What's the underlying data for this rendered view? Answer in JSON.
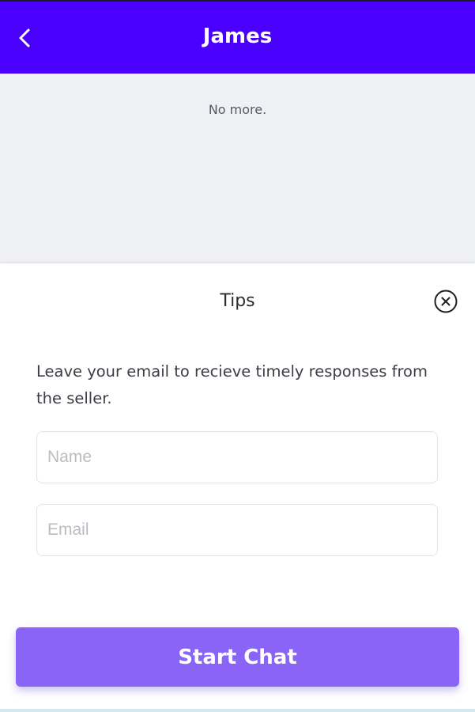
{
  "header": {
    "back_icon": "chevron-left-icon",
    "title": "James",
    "background_color": "#4a00ff"
  },
  "history": {
    "no_more_text": "No more."
  },
  "tips_sheet": {
    "title": "Tips",
    "close_icon": "close-circle-icon",
    "message": "Leave your email to recieve timely responses from the seller.",
    "name_input": {
      "value": "",
      "placeholder": "Name"
    },
    "email_input": {
      "value": "",
      "placeholder": "Email"
    },
    "start_button_label": "Start Chat",
    "button_color": "#8a63f7"
  }
}
